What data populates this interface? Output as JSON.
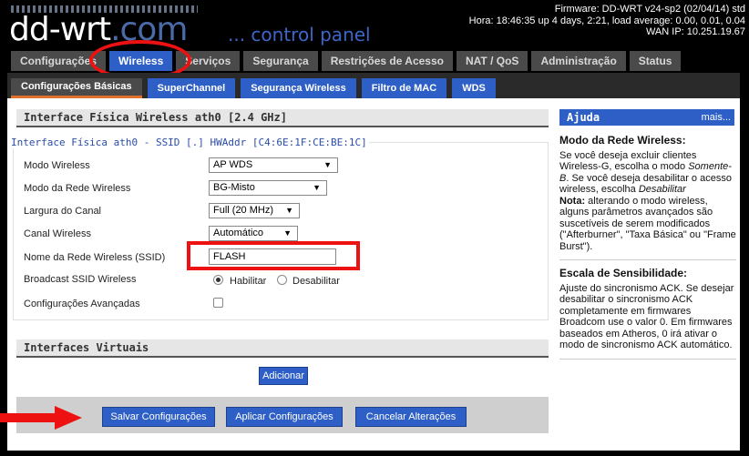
{
  "header": {
    "logo_main": "dd-wrt",
    "logo_com": ".com",
    "tagline": "... control panel",
    "firmware": "Firmware: DD-WRT v24-sp2 (02/04/14) std",
    "uptime": "Hora: 18:46:35 up 4 days, 2:21, load average: 0.00, 0.01, 0.04",
    "wan_ip": "WAN IP: 10.251.19.67"
  },
  "main_tabs": [
    {
      "label": "Configurações"
    },
    {
      "label": "Wireless"
    },
    {
      "label": "Serviços"
    },
    {
      "label": "Segurança"
    },
    {
      "label": "Restrições de Acesso"
    },
    {
      "label": "NAT / QoS"
    },
    {
      "label": "Administração"
    },
    {
      "label": "Status"
    }
  ],
  "sub_tabs": [
    {
      "label": "Configurações Básicas"
    },
    {
      "label": "SuperChannel"
    },
    {
      "label": "Segurança Wireless"
    },
    {
      "label": "Filtro de MAC"
    },
    {
      "label": "WDS"
    }
  ],
  "physical": {
    "section_title": "Interface Física Wireless ath0 [2.4 GHz]",
    "legend": "Interface Física ath0 - SSID [.] HWAddr [C4:6E:1F:CE:BE:1C]",
    "fields": {
      "wireless_mode": {
        "label": "Modo Wireless",
        "value": "AP WDS"
      },
      "network_mode": {
        "label": "Modo da Rede Wireless",
        "value": "BG-Misto"
      },
      "channel_width": {
        "label": "Largura do Canal",
        "value": "Full (20 MHz)"
      },
      "channel": {
        "label": "Canal Wireless",
        "value": "Automático"
      },
      "ssid": {
        "label": "Nome da Rede Wireless (SSID)",
        "value": "FLASH"
      },
      "broadcast": {
        "label": "Broadcast SSID Wireless",
        "enable": "Habilitar",
        "disable": "Desabilitar"
      },
      "advanced": {
        "label": "Configurações Avançadas"
      }
    }
  },
  "virtual": {
    "section_title": "Interfaces Virtuais",
    "add_label": "Adicionar"
  },
  "actions": {
    "save": "Salvar Configurações",
    "apply": "Aplicar Configurações",
    "cancel": "Cancelar Alterações"
  },
  "help": {
    "title": "Ajuda",
    "more": "mais...",
    "s1_title": "Modo da Rede Wireless:",
    "s1_p1": "Se você deseja excluir clientes Wireless-G, escolha o modo ",
    "s1_em1": "Somente-B",
    "s1_p2": ". Se você deseja desabilitar o acesso wireless, escolha ",
    "s1_em2": "Desabilitar",
    "s1_note_label": "Nota:",
    "s1_note": " alterando o modo wireless, alguns parâmetros avançados são suscetíveis de serem modificados (\"Afterburner\", \"Taxa Básica\" ou \"Frame Burst\").",
    "s2_title": "Escala de Sensibilidade:",
    "s2_text": "Ajuste do sincronismo ACK. Se desejar desabilitar o sincronismo ACK completamente em firmwares Broadcom use o valor 0. Em firmwares baseados em Atheros, 0 irá ativar o modo de sincronismo ACK automático."
  },
  "colors": {
    "accent": "#2d5fc6",
    "annotation": "#ee1111",
    "active_tab_underline": "#e0702a"
  }
}
